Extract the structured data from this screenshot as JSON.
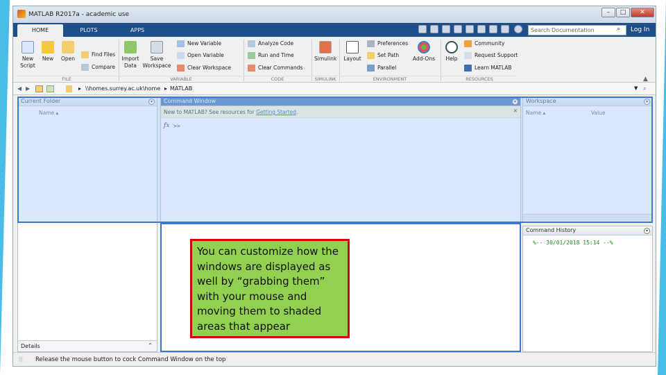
{
  "window": {
    "title": "MATLAB R2017a - academic use"
  },
  "tabs": [
    {
      "label": "HOME"
    },
    {
      "label": "PLOTS"
    },
    {
      "label": "APPS"
    }
  ],
  "search": {
    "placeholder": "Search Documentation"
  },
  "login": "Log In",
  "ribbon": {
    "file": {
      "group": "FILE",
      "new_script": "New\nScript",
      "new": "New",
      "open": "Open",
      "find_files": "Find Files",
      "compare": "Compare"
    },
    "variable": {
      "group": "VARIABLE",
      "import_data": "Import\nData",
      "save_workspace": "Save\nWorkspace",
      "new_variable": "New Variable",
      "open_variable": "Open Variable",
      "clear_workspace": "Clear Workspace"
    },
    "code": {
      "group": "CODE",
      "analyze_code": "Analyze Code",
      "run_and_time": "Run and Time",
      "clear_commands": "Clear Commands"
    },
    "simulink": {
      "group": "SIMULINK",
      "simulink": "Simulink"
    },
    "environment": {
      "group": "ENVIRONMENT",
      "layout": "Layout",
      "preferences": "Preferences",
      "set_path": "Set Path",
      "parallel": "Parallel",
      "add_ons": "Add-Ons"
    },
    "resources": {
      "group": "RESOURCES",
      "help": "Help",
      "community": "Community",
      "request_support": "Request Support",
      "learn_matlab": "Learn MATLAB"
    }
  },
  "address": {
    "path1": "\\\\homes.surrey.ac.uk\\home",
    "path2": "MATLAB"
  },
  "current_folder": {
    "title": "Current Folder",
    "col_name": "Name",
    "details": "Details"
  },
  "command_window": {
    "title": "Command Window",
    "banner_text": "New to MATLAB? See resources for ",
    "banner_link": "Getting Started",
    "banner_end": ".",
    "fx": "fx",
    "prompt": ">>"
  },
  "workspace": {
    "title": "Workspace",
    "col_name": "Name",
    "col_value": "Value"
  },
  "command_history": {
    "title": "Command History",
    "entry": "%-- 30/01/2018 15:14 --%"
  },
  "status": {
    "text": "Release the mouse button to cock Command Window on the top"
  },
  "callout": {
    "text": "You can customize how the windows are displayed as well by “grabbing them” with your mouse and moving them to shaded areas that appear"
  },
  "colors": {
    "tabbar": "#1f4f8a",
    "panel_active": "#3b6fb6",
    "callout_bg": "#92d050",
    "callout_border": "#d50000",
    "accent": "#35b6e6"
  }
}
